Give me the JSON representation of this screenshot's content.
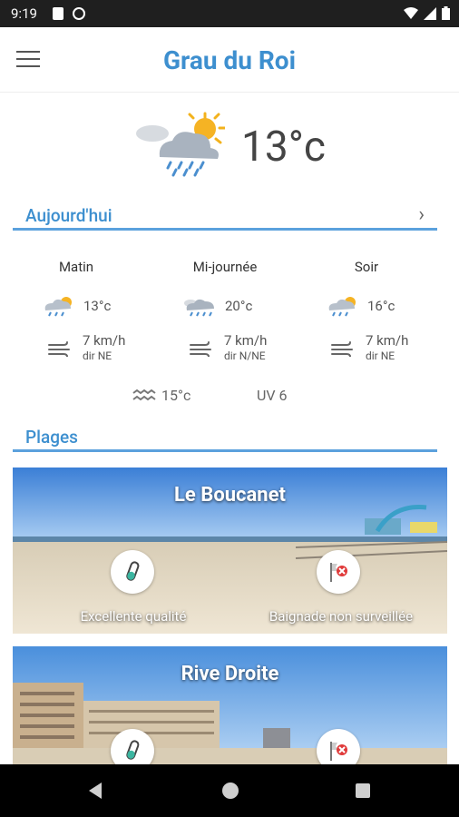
{
  "status_bar": {
    "time": "9:19"
  },
  "header": {
    "title": "Grau du Roi"
  },
  "current": {
    "temperature": "13°c",
    "icon": "rain-sun-cloud-icon"
  },
  "today": {
    "label": "Aujourd'hui",
    "periods": [
      {
        "name": "Matin",
        "temp": "13°c",
        "wind_speed": "7 km/h",
        "wind_dir": "dir NE",
        "icon": "sun-rain-icon"
      },
      {
        "name": "Mi-journée",
        "temp": "20°c",
        "wind_speed": "7 km/h",
        "wind_dir": "dir N/NE",
        "icon": "cloud-rain-icon"
      },
      {
        "name": "Soir",
        "temp": "16°c",
        "wind_speed": "7 km/h",
        "wind_dir": "dir NE",
        "icon": "sun-rain-icon"
      }
    ],
    "water_temp": "15°c",
    "uv": "UV 6"
  },
  "beaches": {
    "label": "Plages",
    "items": [
      {
        "name": "Le Boucanet",
        "water_quality": "Excellente qualité",
        "surveillance": "Baignade non surveillée"
      },
      {
        "name": "Rive Droite",
        "water_quality": "",
        "surveillance": ""
      }
    ]
  },
  "colors": {
    "accent": "#3d8fcf",
    "divider": "#5ba1dd"
  }
}
